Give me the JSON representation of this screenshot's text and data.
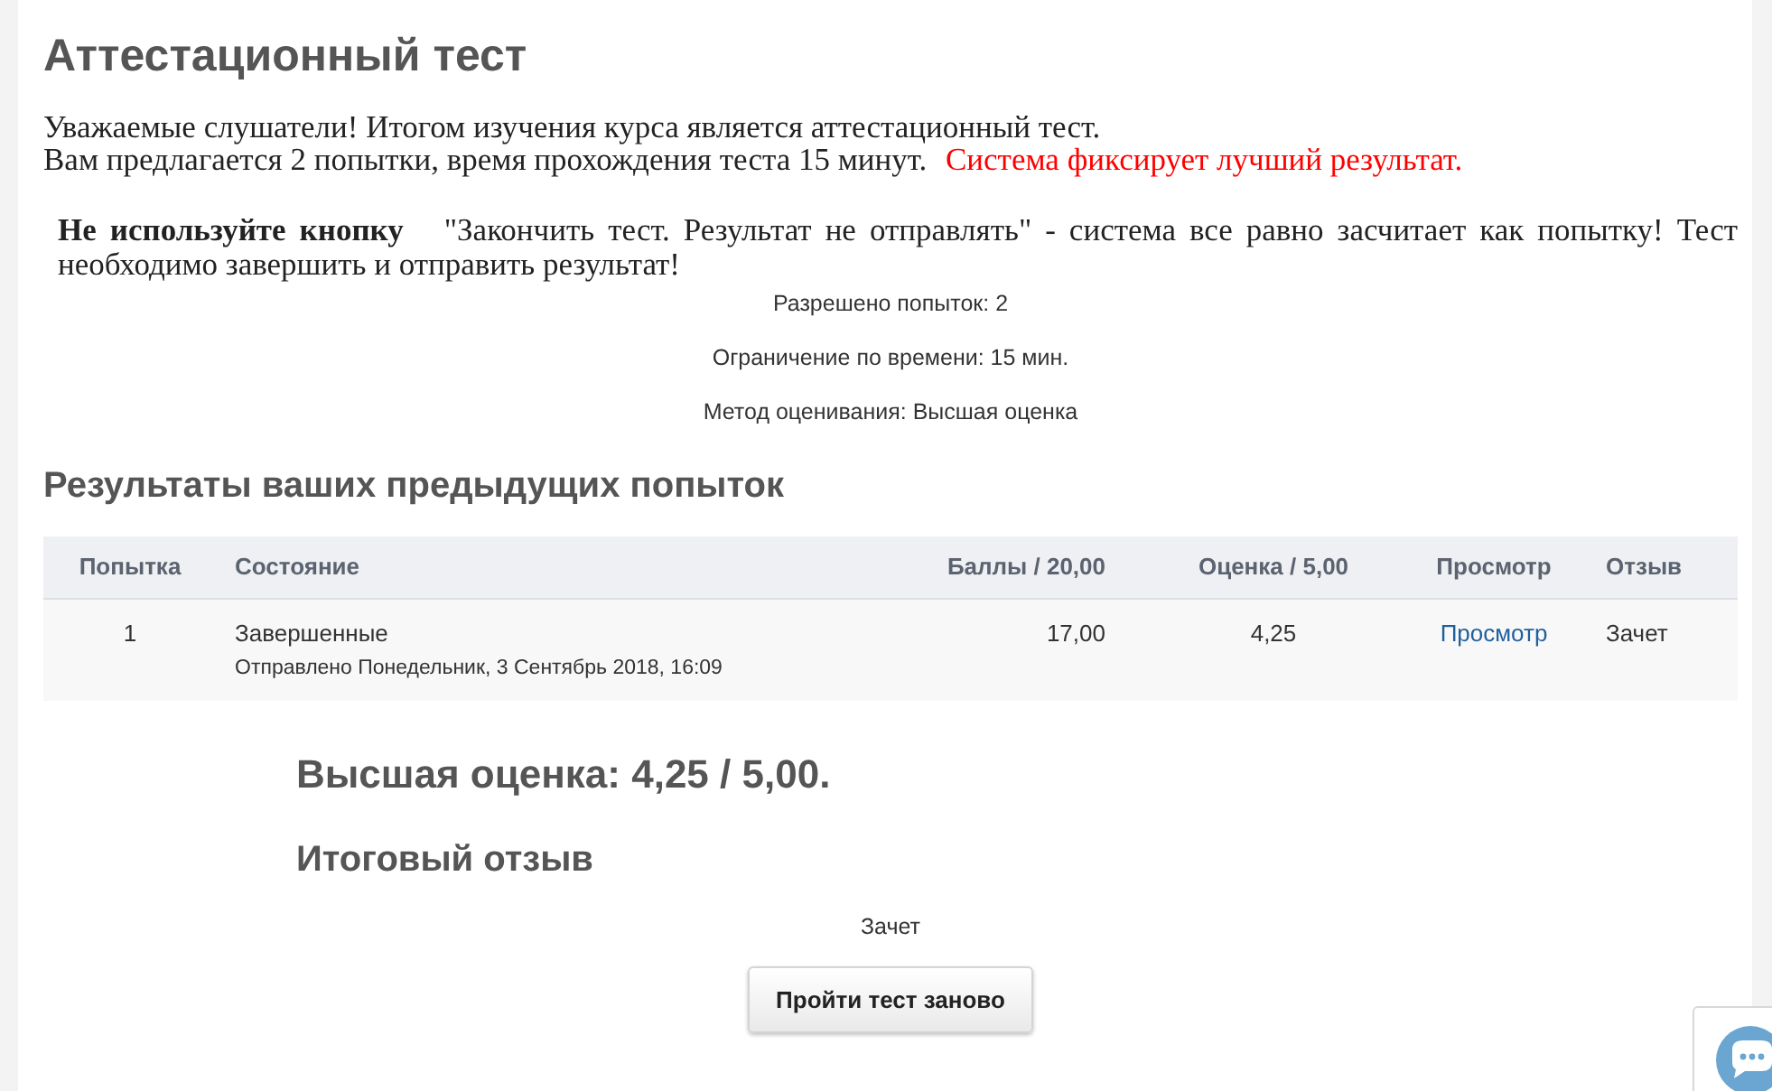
{
  "page_title": "Аттестационный тест",
  "intro": {
    "lines": [
      {
        "segments": [
          {
            "kind": "plain",
            "text": "Уважаемые слушатели! Итогом изучения курса является аттестационный тест."
          }
        ]
      },
      {
        "segments": [
          {
            "kind": "plain",
            "text": "Вам предлагается 2 попытки, время прохождения теста 15 минут."
          },
          {
            "kind": "alert",
            "text": "Система фиксирует лучший результат."
          }
        ]
      }
    ]
  },
  "warning": "**Не используйте кнопку**   \"Закончить тест. Результат не отправлять\" - система все равно засчитает как попытку! Тест необходимо завершить и отправить результат!",
  "quiz_info": [
    "Разрешено попыток: 2",
    "Ограничение по времени: 15 мин.",
    "Метод оценивания: Высшая оценка"
  ],
  "attempts": {
    "title": "Результаты ваших предыдущих попыток",
    "columns": [
      "Попытка",
      "Состояние",
      "Баллы / 20,00",
      "Оценка / 5,00",
      "Просмотр",
      "Отзыв"
    ],
    "rows": [
      {
        "attempt": "1",
        "state": "Завершенные",
        "submitted": "Отправлено Понедельник, 3 Сентябрь 2018, 16:09",
        "points": "17,00",
        "grade": "4,25",
        "review_link": "Просмотр",
        "feedback": "Зачет"
      }
    ]
  },
  "highest_grade": "Высшая оценка: 4,25 / 5,00.",
  "overall_feedback": {
    "title": "Итоговый отзыв",
    "text": "Зачет"
  },
  "retake_button": "Пройти тест заново"
}
